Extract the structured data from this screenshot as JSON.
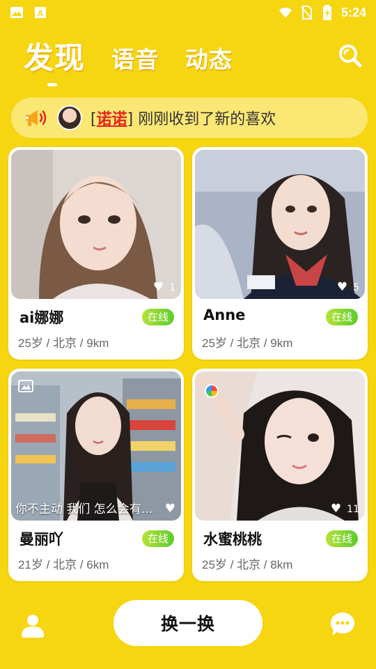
{
  "status_bar": {
    "time": "5:24",
    "icons": [
      "image-icon",
      "text-a-icon",
      "wifi-icon",
      "no-sim-icon",
      "battery-charging-icon"
    ]
  },
  "tabs": [
    {
      "label": "发现",
      "active": true
    },
    {
      "label": "语音",
      "active": false
    },
    {
      "label": "动态",
      "active": false
    }
  ],
  "search_icon": "search-icon",
  "notice": {
    "icon": "megaphone-icon",
    "name_prefix": "[",
    "name": "诺诺",
    "name_suffix": "]",
    "message": " 刚刚收到了新的喜欢"
  },
  "cards": [
    {
      "name": "ai娜娜",
      "status": "在线",
      "meta": "25岁 / 北京 / 9km",
      "likes": "1",
      "caption": ""
    },
    {
      "name": "Anne",
      "status": "在线",
      "meta": "25岁 / 北京 / 9km",
      "likes": "5",
      "caption": ""
    },
    {
      "name": "曼丽吖",
      "status": "在线",
      "meta": "21岁 / 北京 / 6km",
      "likes": "",
      "caption": "你不主动 我们 怎么会有..."
    },
    {
      "name": "水蜜桃桃",
      "status": "在线",
      "meta": "25岁 / 北京 / 8km",
      "likes": "11",
      "caption": ""
    }
  ],
  "bottom": {
    "refresh_label": "换一换",
    "left_icon": "profile-icon",
    "right_icon": "chat-icon"
  },
  "colors": {
    "background": "#F6D511",
    "notice_bg": "#FBE774",
    "online_badge": "#5CCB2C",
    "highlight_name": "#E8231A"
  }
}
